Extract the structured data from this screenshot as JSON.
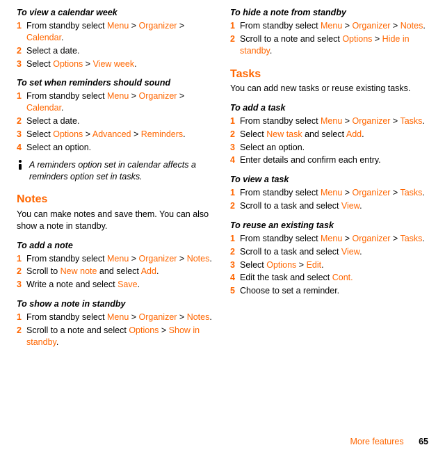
{
  "ui": {
    "menu": "Menu",
    "organizer": "Organizer",
    "calendar": "Calendar",
    "options": "Options",
    "view_week": "View week",
    "advanced": "Advanced",
    "reminders": "Reminders",
    "notes": "Notes",
    "new_note": "New note",
    "add": "Add",
    "save": "Save",
    "show_in_standby": "Show in standby",
    "hide_in_standby": "Hide in standby",
    "tasks": "Tasks",
    "new_task": "New task",
    "view": "View",
    "edit": "Edit",
    "cont": "Cont."
  },
  "left": {
    "h1": "To view a calendar week",
    "s1_1a": "From standby select ",
    "s1_1b": " > ",
    "s1_1c": " > ",
    "s1_1d": ".",
    "s1_2": "Select a date.",
    "s1_3a": "Select ",
    "s1_3b": " > ",
    "s1_3c": ".",
    "h2": "To set when reminders should sound",
    "s2_1a": "From standby select ",
    "s2_1d": ".",
    "s2_2": "Select a date.",
    "s2_3a": "Select ",
    "s2_3d": ".",
    "s2_4": "Select an option.",
    "tip": "A reminders option set in calendar affects a reminders option set in tasks.",
    "notes_head": "Notes",
    "notes_body": "You can make notes and save them. You can also show a note in standby.",
    "h3": "To add a note",
    "s3_1a": "From standby select ",
    "s3_1d": ".",
    "s3_2a": "Scroll to ",
    "s3_2b": " and select ",
    "s3_2c": ".",
    "s3_3a": "Write a note and select ",
    "s3_3b": ".",
    "h4": "To show a note in standby",
    "s4_1a": "From standby select ",
    "s4_1d": ".",
    "s4_2a": "Scroll to a note and select ",
    "s4_2b": " > ",
    "s4_2c": "."
  },
  "right": {
    "h1": "To hide a note from standby",
    "s1_1a": "From standby select ",
    "s1_1d": ".",
    "s1_2a": "Scroll to a note and select ",
    "s1_2b": " > ",
    "s1_2c": ".",
    "tasks_head": "Tasks",
    "tasks_body": "You can add new tasks or reuse existing tasks.",
    "h2": "To add a task",
    "s2_1a": "From standby select ",
    "s2_1d": ".",
    "s2_2a": "Select ",
    "s2_2b": " and select ",
    "s2_2c": ".",
    "s2_3": "Select an option.",
    "s2_4": "Enter details and confirm each entry.",
    "h3": "To view a task",
    "s3_1a": "From standby select ",
    "s3_1d": ".",
    "s3_2a": "Scroll to a task and select ",
    "s3_2b": ".",
    "h4": "To reuse an existing task",
    "s4_1a": "From standby select ",
    "s4_1d": ".",
    "s4_2a": "Scroll to a task and select ",
    "s4_2b": ".",
    "s4_3a": "Select ",
    "s4_3b": " > ",
    "s4_3c": ".",
    "s4_4a": "Edit the task and select ",
    "s4_5": "Choose to set a reminder."
  },
  "footer": {
    "section": "More features",
    "page": "65"
  }
}
